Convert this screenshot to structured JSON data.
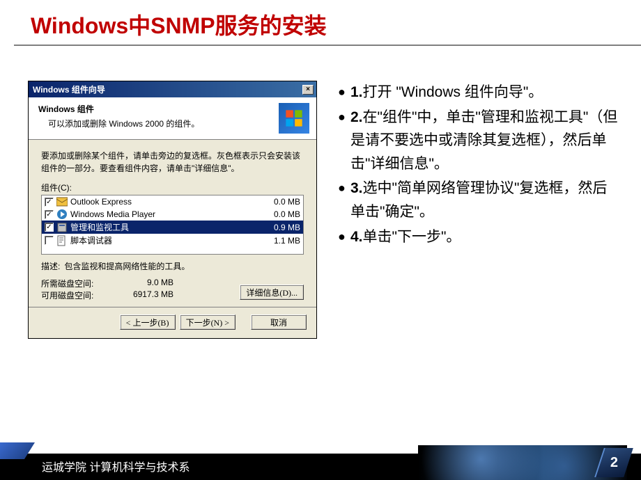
{
  "title": "Windows中SNMP服务的安装",
  "wizard": {
    "window_title": "Windows 组件向导",
    "header_title": "Windows 组件",
    "header_sub": "可以添加或删除 Windows 2000 的组件。",
    "instruction": "要添加或删除某个组件，请单击旁边的复选框。灰色框表示只会安装该组件的一部分。要查看组件内容，请单击\"详细信息\"。",
    "list_label": "组件(C):",
    "components": [
      {
        "checked": true,
        "name": "Outlook Express",
        "size": "0.0 MB",
        "selected": false
      },
      {
        "checked": true,
        "name": "Windows Media Player",
        "size": "0.0 MB",
        "selected": false
      },
      {
        "checked": true,
        "name": "管理和监视工具",
        "size": "0.9 MB",
        "selected": true
      },
      {
        "checked": false,
        "name": "脚本调试器",
        "size": "1.1 MB",
        "selected": false
      }
    ],
    "desc_label": "描述:",
    "desc_text": "包含监视和提高网络性能的工具。",
    "space_required_label": "所需磁盘空间:",
    "space_required_value": "9.0 MB",
    "space_available_label": "可用磁盘空间:",
    "space_available_value": "6917.3 MB",
    "details_btn": "详细信息(D)...",
    "back_btn": "< 上一步(B)",
    "next_btn": "下一步(N) >",
    "cancel_btn": "取消"
  },
  "steps": {
    "s1_num": "1.",
    "s1_text": "打开 \"Windows 组件向导\"。",
    "s2_num": "2.",
    "s2_text": "在\"组件\"中，单击\"管理和监视工具\"（但是请不要选中或清除其复选框），然后单击\"详细信息\"。",
    "s3_num": "3.",
    "s3_text": "选中\"简单网络管理协议\"复选框，然后单击\"确定\"。",
    "s4_num": "4.",
    "s4_text": "单击\"下一步\"。"
  },
  "footer": {
    "org": "运城学院 计算机科学与技术系",
    "page": "2"
  }
}
